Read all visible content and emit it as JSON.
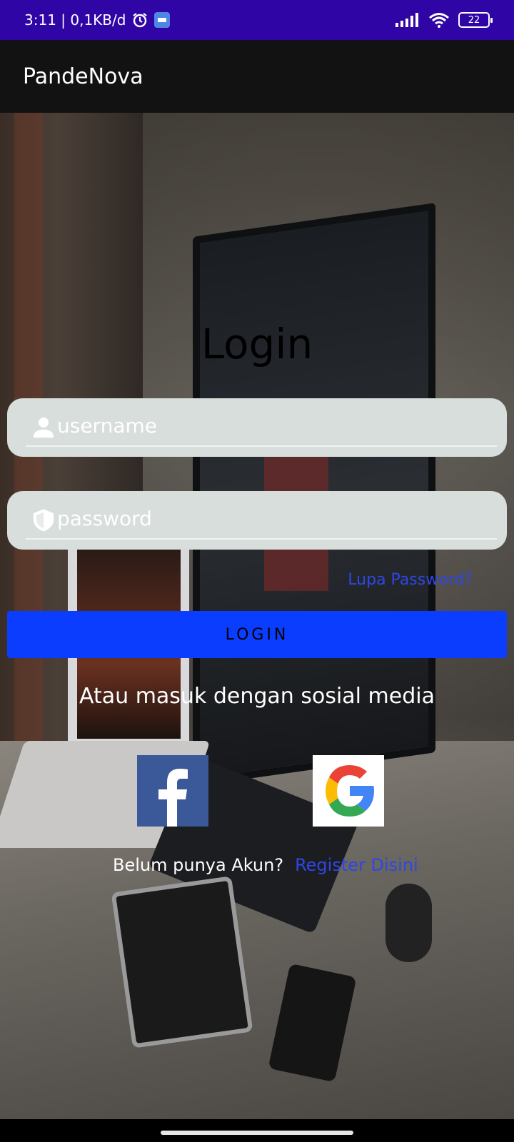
{
  "status_bar": {
    "time_and_speed": "3:11 | 0,1KB/d",
    "battery": "22"
  },
  "app_bar": {
    "title": "PandeNova"
  },
  "login": {
    "title": "Login",
    "username_placeholder": "username",
    "password_placeholder": "password",
    "forgot_password": "Lupa Password?",
    "login_button": "LOGIN",
    "social_title": "Atau masuk dengan sosial media",
    "no_account": "Belum punya Akun?",
    "register_link": "Register Disini"
  },
  "icons": {
    "username": "person-icon",
    "password": "shield-icon",
    "facebook": "facebook-logo",
    "google": "google-logo"
  },
  "colors": {
    "status_bar": "#2f05a6",
    "app_bar": "#121212",
    "login_button": "#0b3dff",
    "link": "#2e47e6",
    "field_bg": "#d8dedb"
  }
}
